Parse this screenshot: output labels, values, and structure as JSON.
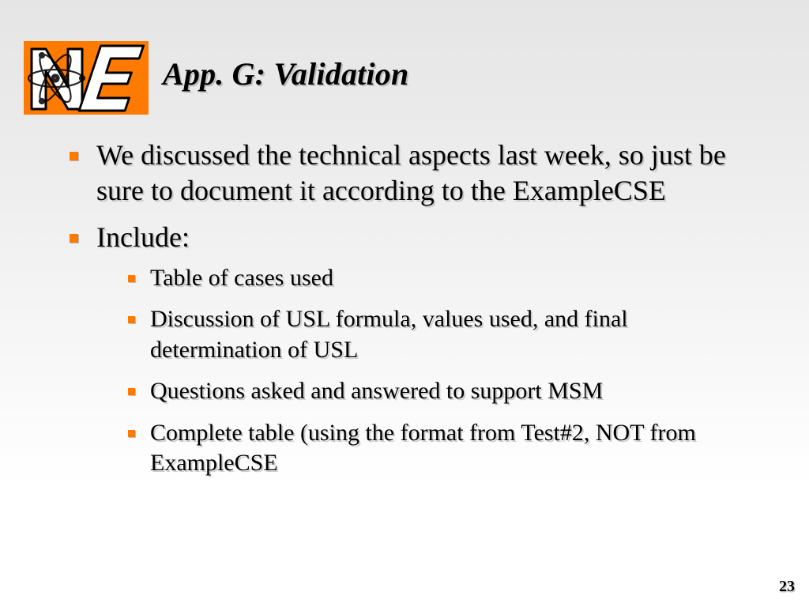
{
  "title": "App. G: Validation",
  "bullets": {
    "b0": "We discussed the technical aspects last week, so just be sure to document it according to the ExampleCSE",
    "b1": "Include:"
  },
  "sub": {
    "s0": "Table of cases used",
    "s1": "Discussion of USL formula, values used, and final determination of USL",
    "s2": "Questions asked and answered to support MSM",
    "s3": "Complete table (using the format from Test#2, NOT from ExampleCSE"
  },
  "page_number": "23",
  "logo": {
    "text_n": "N",
    "text_e": "E"
  }
}
